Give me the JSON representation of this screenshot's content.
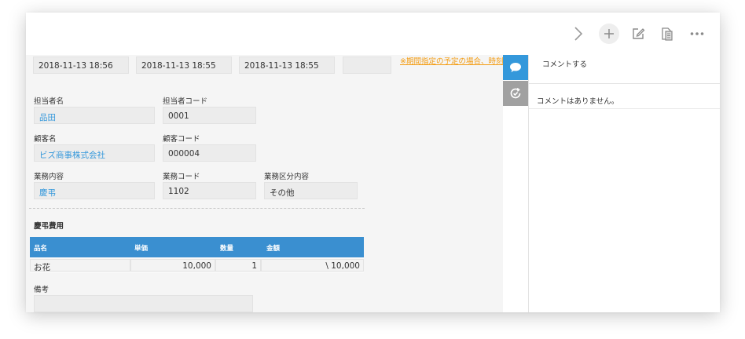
{
  "toolbar": {
    "icons": [
      "chevron-right-icon",
      "plus-icon",
      "edit-icon",
      "copy-icon",
      "more-icon"
    ]
  },
  "top_row": {
    "date1": "2018-11-13 18:56",
    "date2": "2018-11-13 18:55",
    "date3": "2018-11-13 18:55",
    "date4": "",
    "warning_link": "※期間指定の予定の場合、時刻"
  },
  "fields": {
    "assignee": {
      "label": "担当者名",
      "value": "品田"
    },
    "assignee_code": {
      "label": "担当者コード",
      "value": "0001"
    },
    "customer": {
      "label": "顧客名",
      "value": "ビズ商事株式会社"
    },
    "customer_code": {
      "label": "顧客コード",
      "value": "000004"
    },
    "task": {
      "label": "業務内容",
      "value": "慶弔"
    },
    "task_code": {
      "label": "業務コード",
      "value": "1102"
    },
    "task_category": {
      "label": "業務区分内容",
      "value": "その他"
    }
  },
  "table": {
    "title": "慶弔費用",
    "headers": [
      "品名",
      "単価",
      "数量",
      "金額"
    ],
    "rows": [
      {
        "item": "お花",
        "unit_price": "10,000",
        "quantity": "1",
        "amount": "\\ 10,000"
      }
    ]
  },
  "notes": {
    "label": "備考",
    "value": ""
  },
  "comments": {
    "input_placeholder": "コメントする",
    "empty_text": "コメントはありません。"
  },
  "colors": {
    "accent": "#3498db",
    "table_header": "#3a8fd0",
    "warning": "#f39c12",
    "history_tab": "#a1a1a1"
  }
}
